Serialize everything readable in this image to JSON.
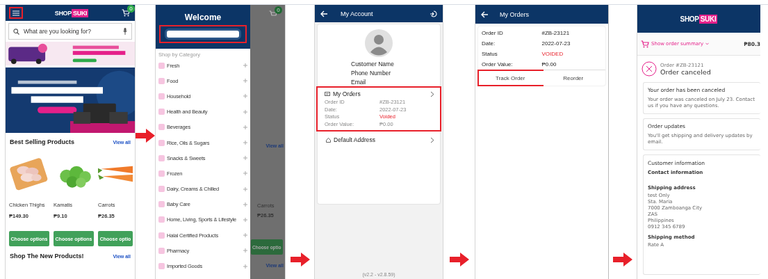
{
  "home": {
    "header": {
      "logo": {
        "text": "SHOP",
        "accent": "SUKI"
      },
      "cart_count": "0",
      "menu_highlighted": true
    },
    "search": {
      "placeholder": "What are you looking for?"
    },
    "sections": [
      {
        "title": "Best Selling Products",
        "link": "View all",
        "products": [
          {
            "name": "Chicken Thighs",
            "price": "₱149.30",
            "button": "Choose options",
            "kind": "meat"
          },
          {
            "name": "Kamatis",
            "price": "₱9.10",
            "button": "Choose options",
            "kind": "tomato"
          },
          {
            "name": "Carrots",
            "price": "₱26.35",
            "button": "Choose optio",
            "kind": "carrot"
          }
        ]
      },
      {
        "title": "Shop The New Products!",
        "link": "View all"
      }
    ]
  },
  "menu": {
    "title": "Welcome",
    "name_field": {
      "highlighted": true
    },
    "section": "Shop by Category",
    "categories": [
      "Fresh",
      "Food",
      "Household",
      "Health and Beauty",
      "Beverages",
      "Rice, Oils & Sugars",
      "Snacks & Sweets",
      "Frozen",
      "Dairy, Creams & Chilled",
      "Baby Care",
      "Home, Living, Sports & Lifestyle",
      "Halal Certified Products",
      "Pharmacy",
      "Imported Goods"
    ],
    "background": {
      "cart_count": "0",
      "links": [
        "View all",
        "View all"
      ],
      "product_name": "Carrots",
      "price": "₱26.35",
      "button": "Choose optio"
    }
  },
  "account": {
    "title": "My Account",
    "profile": [
      "Customer Name",
      "Phone Number",
      "Email"
    ],
    "orders_card": {
      "title": "My Orders",
      "highlighted": true,
      "rows": [
        {
          "label": "Order ID",
          "value": "#ZB-23121",
          "kind": "plain"
        },
        {
          "label": "Date:",
          "value": "2022-07-23",
          "kind": "plain"
        },
        {
          "label": "Status",
          "value": "Voided",
          "kind": "status"
        },
        {
          "label": "Order Value:",
          "value": "₱0.00",
          "kind": "plain"
        }
      ]
    },
    "address": "Default Address",
    "version": "(v2.2 - v2.8.59)"
  },
  "orders": {
    "title": "My Orders",
    "rows": [
      {
        "label": "Order ID",
        "value": "#ZB-23121",
        "kind": "plain"
      },
      {
        "label": "Date:",
        "value": "2022-07-23",
        "kind": "plain"
      },
      {
        "label": "Status",
        "value": "VOIDED",
        "kind": "status"
      },
      {
        "label": "Order Value:",
        "value": "₱0.00",
        "kind": "plain"
      }
    ],
    "actions": [
      {
        "label": "Track Order",
        "highlighted": true
      },
      {
        "label": "Reorder",
        "highlighted": false
      }
    ]
  },
  "order_status": {
    "logo": {
      "text": "SHOP",
      "accent": "SUKI"
    },
    "summary_link": "Show order summary",
    "total": "₱80.3",
    "order_number": "Order #ZB-23121",
    "title": "Order canceled",
    "cards": [
      {
        "title": "Your order has been canceled",
        "text": "Your order was canceled on July 23. Contact us if you have any questions."
      },
      {
        "title": "Order updates",
        "text": "You'll get shipping and delivery updates by email."
      }
    ],
    "customer": {
      "title": "Customer information",
      "sections": [
        {
          "heading": "Contact information"
        },
        {
          "heading": "Shipping address",
          "lines": [
            "test Only",
            "Sta. Maria",
            "7000 Zamboanga City",
            "ZAS",
            "Philippines",
            "0912 345 6789"
          ]
        },
        {
          "heading": "Shipping method",
          "lines": [
            "Rate A"
          ]
        }
      ]
    }
  }
}
